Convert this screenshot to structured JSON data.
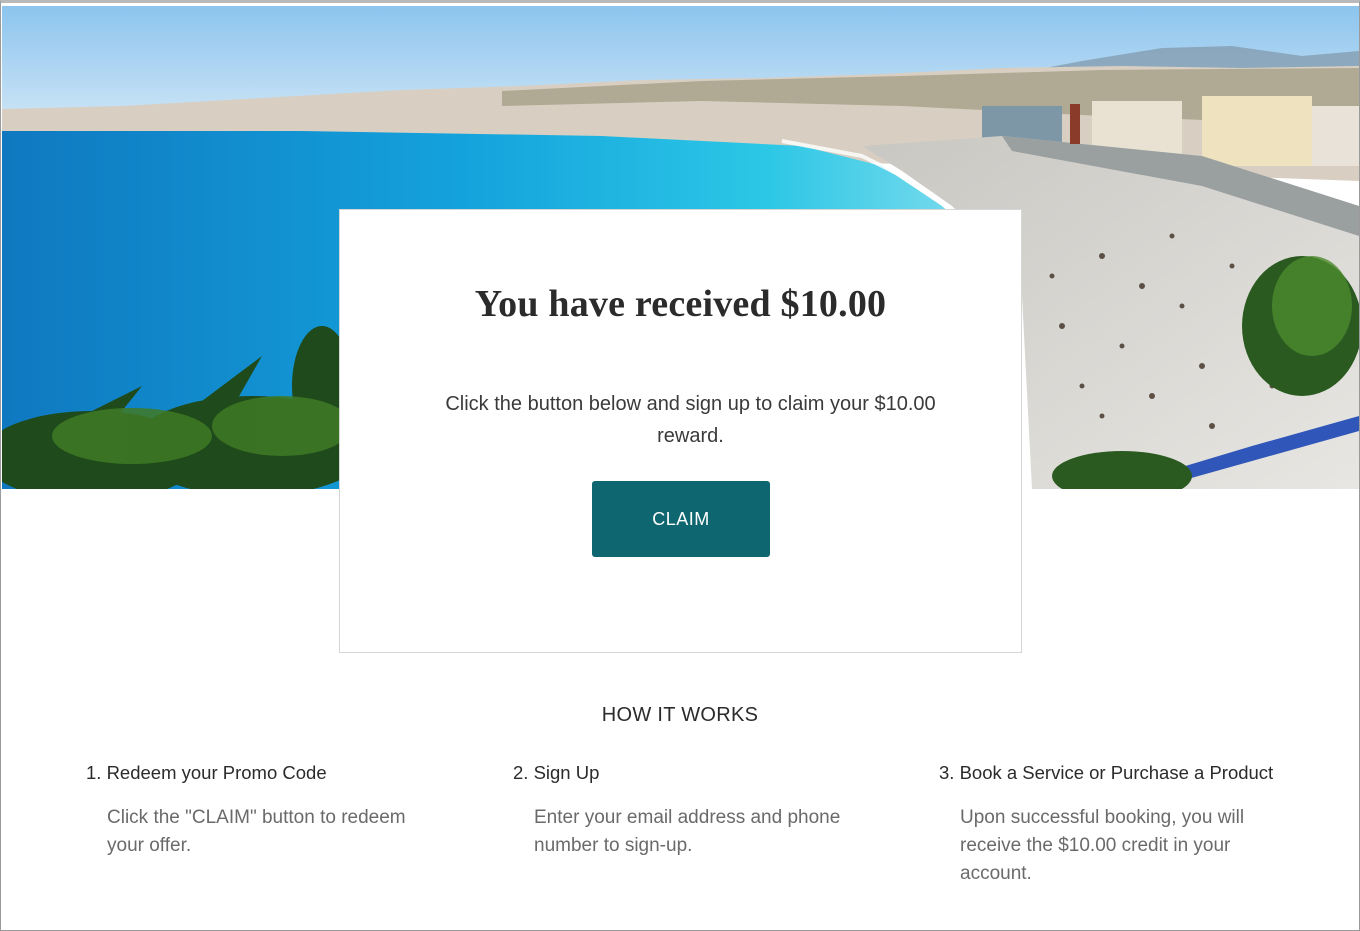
{
  "hero": {
    "image_alt": "Coastal city beach with turquoise water and palm trees"
  },
  "card": {
    "title": "You have received $10.00",
    "body": "Click the button below and sign up to claim your $10.00 reward.",
    "claim_label": "CLAIM"
  },
  "how_it_works": {
    "title": "HOW IT WORKS",
    "steps": [
      {
        "title": "1. Redeem your Promo Code",
        "text": "Click the \"CLAIM\" button to redeem your offer."
      },
      {
        "title": "2. Sign Up",
        "text": "Enter your email address and phone number to sign-up."
      },
      {
        "title": "3. Book a Service or Purchase a Product",
        "text": "Upon successful booking, you will receive the $10.00 credit in your account."
      }
    ]
  },
  "colors": {
    "button": "#0e6670",
    "sea": "#1aa3d6",
    "sky": "#a9d3f0"
  }
}
